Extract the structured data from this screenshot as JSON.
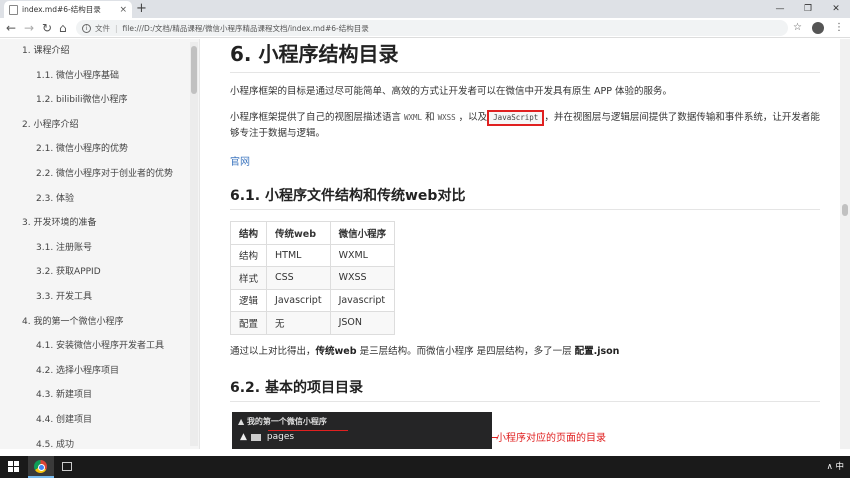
{
  "browser": {
    "tab_title": "index.md#6-结构目录",
    "tab_close": "×",
    "new_tab": "+",
    "url_scheme_label": "文件",
    "url": "file:///D:/文档/精品课程/微信小程序精品课程文档/index.md#6-结构目录",
    "window_controls": [
      "—",
      "❐",
      "✕"
    ]
  },
  "toc": [
    {
      "label": "1. 课程介绍",
      "level": 1
    },
    {
      "label": "1.1. 微信小程序基础",
      "level": 2
    },
    {
      "label": "1.2. bilibili微信小程序",
      "level": 2
    },
    {
      "label": "2. 小程序介绍",
      "level": 1
    },
    {
      "label": "2.1. 微信小程序的优势",
      "level": 2
    },
    {
      "label": "2.2. 微信小程序对于创业者的优势",
      "level": 2
    },
    {
      "label": "2.3. 体验",
      "level": 2
    },
    {
      "label": "3. 开发环境的准备",
      "level": 1
    },
    {
      "label": "3.1. 注册账号",
      "level": 2
    },
    {
      "label": "3.2. 获取APPID",
      "level": 2
    },
    {
      "label": "3.3. 开发工具",
      "level": 2
    },
    {
      "label": "4. 我的第一个微信小程序",
      "level": 1
    },
    {
      "label": "4.1. 安装微信小程序开发者工具",
      "level": 2
    },
    {
      "label": "4.2. 选择小程序项目",
      "level": 2
    },
    {
      "label": "4.3. 新建项目",
      "level": 2
    },
    {
      "label": "4.4. 创建项目",
      "level": 2
    },
    {
      "label": "4.5. 成功",
      "level": 2
    }
  ],
  "content": {
    "h1": "6. 小程序结构目录",
    "intro": "小程序框架的目标是通过尽可能简单、高效的方式让开发者可以在微信中开发具有原生 APP 体验的服务。",
    "p2_a": "小程序框架提供了自己的视图层描述语言",
    "p2_code1": "WXML",
    "p2_and": "和",
    "p2_code2": "WXSS",
    "p2_b": "，以及",
    "p2_code3": "JavaScript",
    "p2_c": "，并在视图层与逻辑层间提供了数据传输和事件系统，让开发者能够专注于数据与逻辑。",
    "link": "官网",
    "h2_1": "6.1. 小程序文件结构和传统web对比",
    "table": {
      "headers": [
        "结构",
        "传统web",
        "微信小程序"
      ],
      "rows": [
        [
          "结构",
          "HTML",
          "WXML"
        ],
        [
          "样式",
          "CSS",
          "WXSS"
        ],
        [
          "逻辑",
          "Javascript",
          "Javascript"
        ],
        [
          "配置",
          "无",
          "JSON"
        ]
      ]
    },
    "conclusion_a": "通过以上对比得出，",
    "conclusion_b": "传统web",
    "conclusion_c": " 是三层结构。而微信小程序 是四层结构，多了一层 ",
    "conclusion_d": "配置.json",
    "h2_2": "6.2. 基本的项目目录",
    "img_row1": "我的第一个微信小程序",
    "img_row2": "pages",
    "annotation": "小程序对应的页面的目录"
  },
  "taskbar": {
    "tray_text": "∧ 中"
  }
}
